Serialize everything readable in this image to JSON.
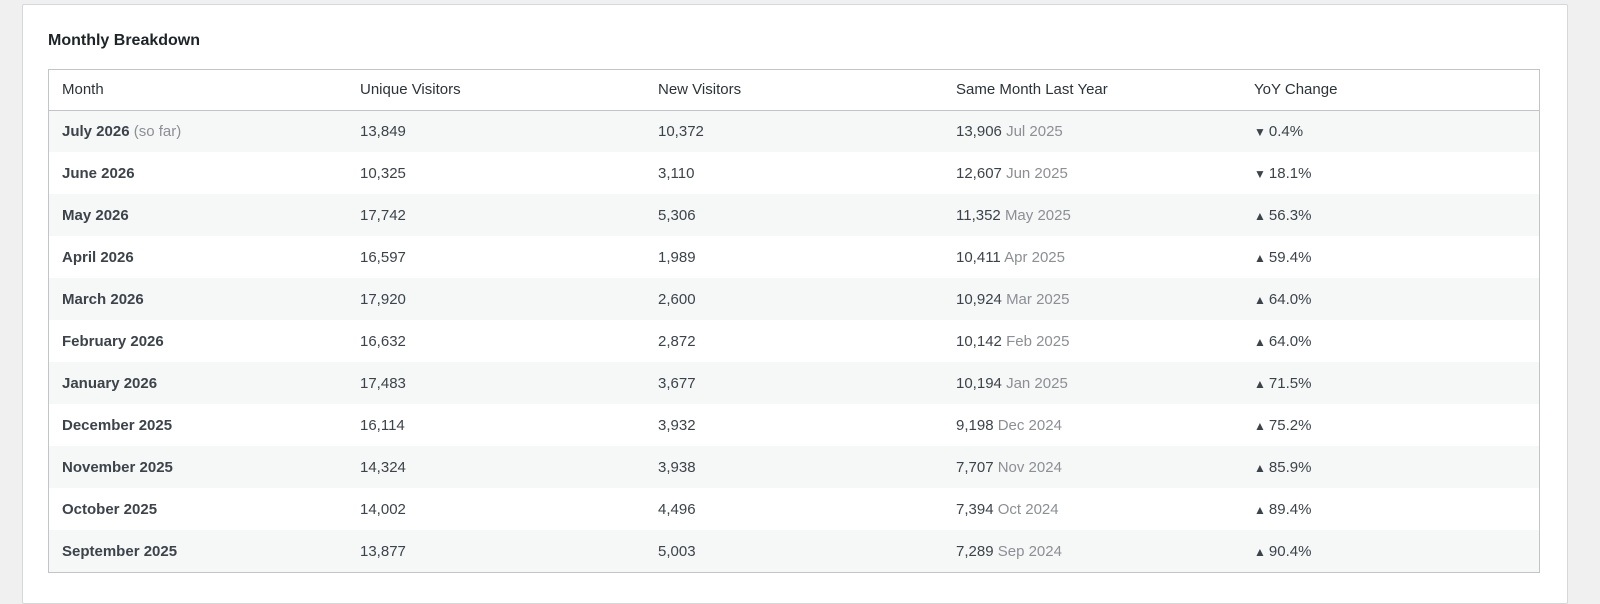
{
  "panel": {
    "title": "Monthly Breakdown"
  },
  "table": {
    "columns": [
      "Month",
      "Unique Visitors",
      "New Visitors",
      "Same Month Last Year",
      "YoY Change"
    ],
    "rows": [
      {
        "month": "July 2026",
        "note": "(so far)",
        "unique": "13,849",
        "new": "10,372",
        "last_year_value": "13,906",
        "last_year_month": "Jul 2025",
        "direction": "down",
        "arrow": "▼",
        "change": "0.4%"
      },
      {
        "month": "June 2026",
        "note": "",
        "unique": "10,325",
        "new": "3,110",
        "last_year_value": "12,607",
        "last_year_month": "Jun 2025",
        "direction": "down",
        "arrow": "▼",
        "change": "18.1%"
      },
      {
        "month": "May 2026",
        "note": "",
        "unique": "17,742",
        "new": "5,306",
        "last_year_value": "11,352",
        "last_year_month": "May 2025",
        "direction": "up",
        "arrow": "▲",
        "change": "56.3%"
      },
      {
        "month": "April 2026",
        "note": "",
        "unique": "16,597",
        "new": "1,989",
        "last_year_value": "10,411",
        "last_year_month": "Apr 2025",
        "direction": "up",
        "arrow": "▲",
        "change": "59.4%"
      },
      {
        "month": "March 2026",
        "note": "",
        "unique": "17,920",
        "new": "2,600",
        "last_year_value": "10,924",
        "last_year_month": "Mar 2025",
        "direction": "up",
        "arrow": "▲",
        "change": "64.0%"
      },
      {
        "month": "February 2026",
        "note": "",
        "unique": "16,632",
        "new": "2,872",
        "last_year_value": "10,142",
        "last_year_month": "Feb 2025",
        "direction": "up",
        "arrow": "▲",
        "change": "64.0%"
      },
      {
        "month": "January 2026",
        "note": "",
        "unique": "17,483",
        "new": "3,677",
        "last_year_value": "10,194",
        "last_year_month": "Jan 2025",
        "direction": "up",
        "arrow": "▲",
        "change": "71.5%"
      },
      {
        "month": "December 2025",
        "note": "",
        "unique": "16,114",
        "new": "3,932",
        "last_year_value": "9,198",
        "last_year_month": "Dec 2024",
        "direction": "up",
        "arrow": "▲",
        "change": "75.2%"
      },
      {
        "month": "November 2025",
        "note": "",
        "unique": "14,324",
        "new": "3,938",
        "last_year_value": "7,707",
        "last_year_month": "Nov 2024",
        "direction": "up",
        "arrow": "▲",
        "change": "85.9%"
      },
      {
        "month": "October 2025",
        "note": "",
        "unique": "14,002",
        "new": "4,496",
        "last_year_value": "7,394",
        "last_year_month": "Oct 2024",
        "direction": "up",
        "arrow": "▲",
        "change": "89.4%"
      },
      {
        "month": "September 2025",
        "note": "",
        "unique": "13,877",
        "new": "5,003",
        "last_year_value": "7,289",
        "last_year_month": "Sep 2024",
        "direction": "up",
        "arrow": "▲",
        "change": "90.4%"
      }
    ]
  },
  "colors": {
    "page_background": "#f0f0f1",
    "panel_background": "#ffffff",
    "row_stripe": "#f6f7f7",
    "border": "#c3c4c7",
    "text": "#3c434a",
    "muted_text": "#8c8f94"
  }
}
